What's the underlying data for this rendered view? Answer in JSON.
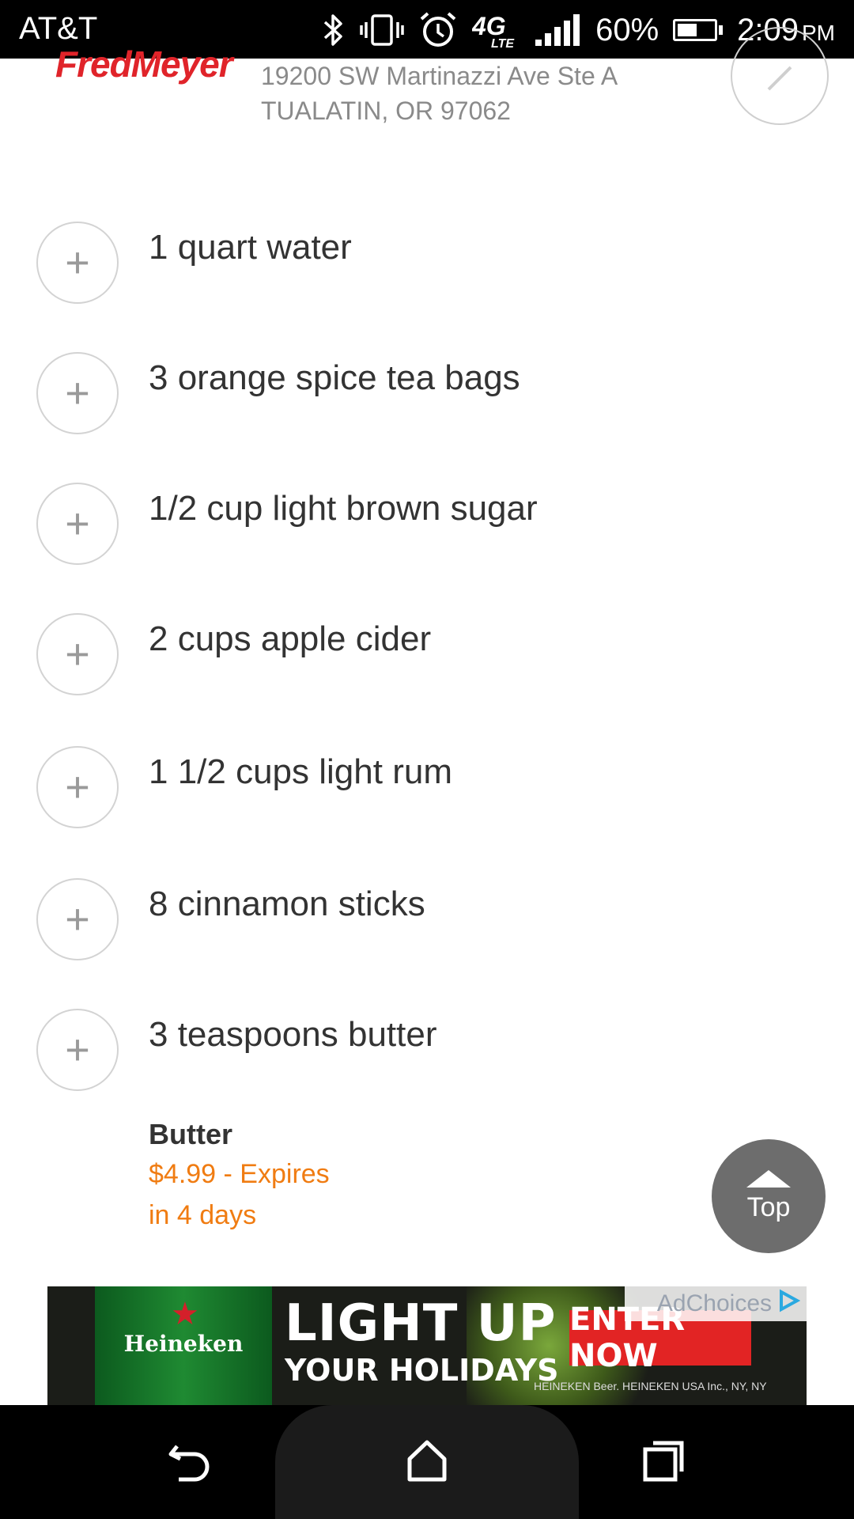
{
  "status_bar": {
    "carrier": "AT&T",
    "network": "4G LTE",
    "battery_percent": "60%",
    "battery_level": 0.6,
    "time": "2:09",
    "ampm": "PM",
    "icons": [
      "bluetooth-icon",
      "vibrate-icon",
      "alarm-icon",
      "lte-icon",
      "signal-icon",
      "battery-icon"
    ]
  },
  "store": {
    "logo": "FredMeyer",
    "address_line1": "19200 SW Martinazzi Ave Ste A",
    "address_line2": "TUALATIN, OR 97062",
    "arrow_icon": "chevron-right-icon"
  },
  "ingredients": [
    {
      "label": "1 quart water"
    },
    {
      "label": "3 orange spice tea bags"
    },
    {
      "label": "1/2 cup light brown sugar"
    },
    {
      "label": "2 cups apple cider"
    },
    {
      "label": "1 1/2 cups light rum"
    },
    {
      "label": "8 cinnamon sticks"
    },
    {
      "label": "3 teaspoons butter"
    }
  ],
  "deal": {
    "title": "Butter",
    "price_line1": "$4.99 - Expires",
    "price_line2": "in 4 days",
    "color": "#f07c12"
  },
  "top_button": {
    "label": "Top"
  },
  "ad": {
    "brand": "Heineken",
    "headline": "LIGHT UP",
    "subline": "YOUR HOLIDAYS",
    "cta": "ENTER NOW",
    "ad_choices": "AdChoices",
    "fine_print": "HEINEKEN Beer. HEINEKEN USA Inc., NY, NY"
  },
  "nav": {
    "back_icon": "back-icon",
    "home_icon": "home-icon",
    "recents_icon": "recents-icon"
  },
  "colors": {
    "accent_orange": "#f07c12",
    "brand_red": "#e0242a",
    "top_button_gray": "#6d6d6d"
  }
}
